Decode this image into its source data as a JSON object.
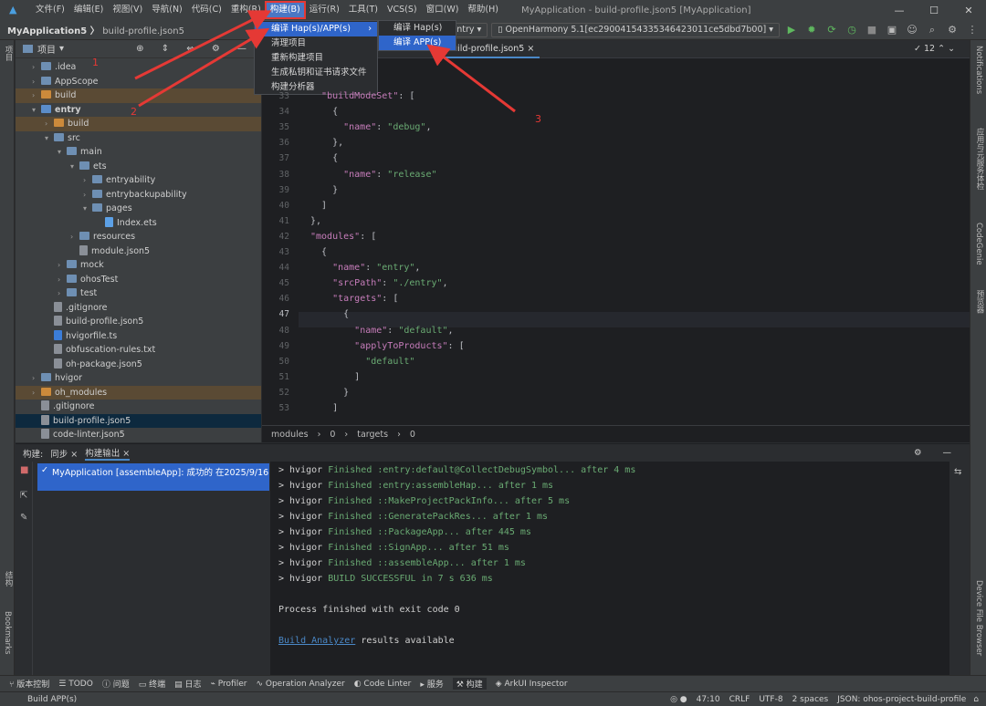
{
  "app": {
    "window_title": "MyApplication - build-profile.json5 [MyApplication]",
    "menu": [
      "文件(F)",
      "编辑(E)",
      "视图(V)",
      "导航(N)",
      "代码(C)",
      "重构(R)",
      "构建(B)",
      "运行(R)",
      "工具(T)",
      "VCS(S)",
      "窗口(W)",
      "帮助(H)"
    ],
    "active_menu_index": 6,
    "window_controls": [
      "—",
      "☐",
      "✕"
    ]
  },
  "toolbar": {
    "project": "MyApplication5",
    "file": "build-profile.json5",
    "module": "entry",
    "device": "OpenHarmony 5.1[ec29004154335346423011ce5dbd7b00]"
  },
  "build_menu": {
    "items": [
      "编译 Hap(s)/APP(s)",
      "清理项目",
      "重新构建项目",
      "生成私钥和证书请求文件",
      "构建分析器"
    ],
    "submenu": [
      "编译 Hap(s)",
      "编译 APP(s)"
    ]
  },
  "project_panel": {
    "title": "项目",
    "tree": [
      {
        "label": ".idea",
        "type": "folder",
        "depth": 0,
        "expanded": false
      },
      {
        "label": "AppScope",
        "type": "folder",
        "depth": 0,
        "expanded": false
      },
      {
        "label": "build",
        "type": "folder-orange",
        "depth": 0,
        "expanded": false
      },
      {
        "label": "entry",
        "type": "module",
        "depth": 0,
        "expanded": true
      },
      {
        "label": "build",
        "type": "folder-orange",
        "depth": 1,
        "expanded": false
      },
      {
        "label": "src",
        "type": "folder",
        "depth": 1,
        "expanded": true
      },
      {
        "label": "main",
        "type": "folder",
        "depth": 2,
        "expanded": true
      },
      {
        "label": "ets",
        "type": "folder",
        "depth": 3,
        "expanded": true
      },
      {
        "label": "entryability",
        "type": "folder",
        "depth": 4,
        "expanded": false
      },
      {
        "label": "entrybackupability",
        "type": "folder",
        "depth": 4,
        "expanded": false
      },
      {
        "label": "pages",
        "type": "folder",
        "depth": 4,
        "expanded": true
      },
      {
        "label": "Index.ets",
        "type": "ets",
        "depth": 5
      },
      {
        "label": "resources",
        "type": "folder",
        "depth": 3,
        "expanded": false
      },
      {
        "label": "module.json5",
        "type": "file",
        "depth": 3
      },
      {
        "label": "mock",
        "type": "folder",
        "depth": 2,
        "expanded": false
      },
      {
        "label": "ohosTest",
        "type": "folder",
        "depth": 2,
        "expanded": false
      },
      {
        "label": "test",
        "type": "folder",
        "depth": 2,
        "expanded": false
      },
      {
        "label": ".gitignore",
        "type": "file",
        "depth": 1
      },
      {
        "label": "build-profile.json5",
        "type": "file",
        "depth": 1
      },
      {
        "label": "hvigorfile.ts",
        "type": "ts",
        "depth": 1
      },
      {
        "label": "obfuscation-rules.txt",
        "type": "file",
        "depth": 1
      },
      {
        "label": "oh-package.json5",
        "type": "file",
        "depth": 1
      },
      {
        "label": "hvigor",
        "type": "folder",
        "depth": 0,
        "expanded": false
      },
      {
        "label": "oh_modules",
        "type": "folder-orange",
        "depth": 0,
        "expanded": false
      },
      {
        "label": ".gitignore",
        "type": "file",
        "depth": 0
      },
      {
        "label": "build-profile.json5",
        "type": "file",
        "depth": 0,
        "selected": true
      },
      {
        "label": "code-linter.json5",
        "type": "file",
        "depth": 0
      }
    ]
  },
  "editor": {
    "tabs": [
      "Index.ets",
      "build-profile.json5"
    ],
    "active_tab": 1,
    "inspection_count": "12",
    "lines": [
      {
        "n": "33",
        "text": "  \"buildModeSet\": ["
      },
      {
        "n": "34",
        "text": "    {"
      },
      {
        "n": "35",
        "text": "      \"name\": \"debug\","
      },
      {
        "n": "36",
        "text": "    },"
      },
      {
        "n": "37",
        "text": "    {"
      },
      {
        "n": "38",
        "text": "      \"name\": \"release\""
      },
      {
        "n": "39",
        "text": "    }"
      },
      {
        "n": "40",
        "text": "  ]"
      },
      {
        "n": "41",
        "text": "},"
      },
      {
        "n": "42",
        "text": "\"modules\": ["
      },
      {
        "n": "43",
        "text": "  {"
      },
      {
        "n": "44",
        "text": "    \"name\": \"entry\","
      },
      {
        "n": "45",
        "text": "    \"srcPath\": \"./entry\","
      },
      {
        "n": "46",
        "text": "    \"targets\": ["
      },
      {
        "n": "47",
        "text": "      {"
      },
      {
        "n": "48",
        "text": "        \"name\": \"default\","
      },
      {
        "n": "49",
        "text": "        \"applyToProducts\": ["
      },
      {
        "n": "50",
        "text": "          \"default\""
      },
      {
        "n": "51",
        "text": "        ]"
      },
      {
        "n": "52",
        "text": "      }"
      },
      {
        "n": "53",
        "text": "    ]"
      }
    ],
    "breadcrumb": [
      "modules",
      "0",
      "targets",
      "0"
    ]
  },
  "build_panel": {
    "label": "构建:",
    "tabs": [
      "同步",
      "构建输出"
    ],
    "active_tab": 1,
    "tree_item": "MyApplication [assembleApp]: 成功的 在2025/9/16",
    "output": [
      {
        "pre": "> hvigor ",
        "msg": "Finished :entry:default@CollectDebugSymbol... after 4 ms"
      },
      {
        "pre": "> hvigor ",
        "msg": "Finished :entry:assembleHap... after 1 ms"
      },
      {
        "pre": "> hvigor ",
        "msg": "Finished ::MakeProjectPackInfo... after 5 ms"
      },
      {
        "pre": "> hvigor ",
        "msg": "Finished ::GeneratePackRes... after 1 ms"
      },
      {
        "pre": "> hvigor ",
        "msg": "Finished ::PackageApp... after 445 ms"
      },
      {
        "pre": "> hvigor ",
        "msg": "Finished ::SignApp... after 51 ms"
      },
      {
        "pre": "> hvigor ",
        "msg": "Finished ::assembleApp... after 1 ms"
      },
      {
        "pre": "> hvigor ",
        "msg": "BUILD SUCCESSFUL in 7 s 636 ms"
      }
    ],
    "exit_line": "Process finished with exit code 0",
    "analyzer_link": "Build Analyzer",
    "analyzer_tail": " results available"
  },
  "tool_windows": [
    "版本控制",
    "TODO",
    "问题",
    "终端",
    "日志",
    "Profiler",
    "Operation Analyzer",
    "Code Linter",
    "服务",
    "构建",
    "ArkUI Inspector"
  ],
  "active_tool_window": 9,
  "status": {
    "left": "Build APP(s)",
    "position": "47:10",
    "line_sep": "CRLF",
    "encoding": "UTF-8",
    "indent": "2 spaces",
    "schema": "JSON: ohos-project-build-profile"
  },
  "side_labels": {
    "left_top": "项目",
    "left_mid": "结构",
    "left_bottom": "Bookmarks",
    "right_1": "Notifications",
    "right_2": "应用与元服务体检",
    "right_3": "CodeGenie",
    "right_4": "预览器",
    "right_5": "Device File Browser"
  },
  "annotations": [
    "1",
    "2",
    "3"
  ],
  "colors": {
    "accent": "#2f65ca",
    "annotation": "#e53935",
    "string": "#6aab73",
    "key": "#c77dbb"
  }
}
